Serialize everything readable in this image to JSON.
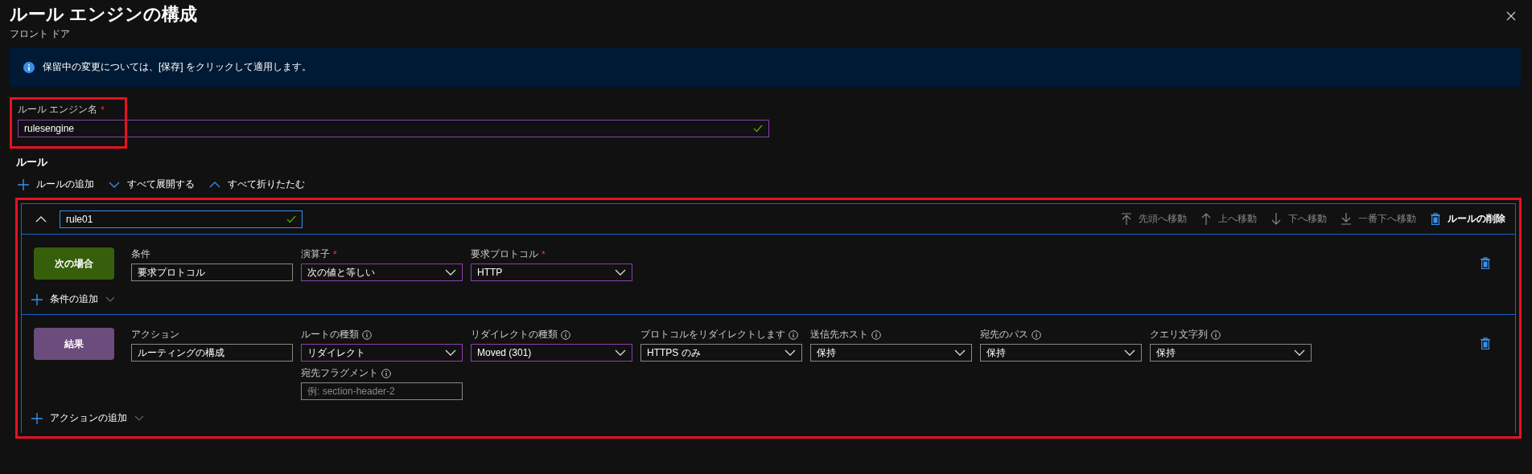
{
  "panel": {
    "title": "ルール エンジンの構成",
    "subtitle": "フロント ドア"
  },
  "banner": {
    "text": "保留中の変更については、[保存] をクリックして適用します。"
  },
  "engine_name": {
    "label": "ルール エンジン名",
    "required_mark": "*",
    "value": "rulesengine",
    "valid": true,
    "highlighted": true
  },
  "rules_section": {
    "heading": "ルール",
    "actions": [
      {
        "kind": "add",
        "label": "ルールの追加"
      },
      {
        "kind": "expand",
        "label": "すべて展開する"
      },
      {
        "kind": "collapse",
        "label": "すべて折りたたむ"
      }
    ]
  },
  "rule": {
    "name": "rule01",
    "valid": true,
    "expanded": true,
    "highlighted": true,
    "commands": [
      {
        "kind": "top",
        "label": "先頭へ移動",
        "disabled": true
      },
      {
        "kind": "up",
        "label": "上へ移動",
        "disabled": true
      },
      {
        "kind": "down",
        "label": "下へ移動",
        "disabled": true
      },
      {
        "kind": "bottom",
        "label": "一番下へ移動",
        "disabled": true
      },
      {
        "kind": "delete",
        "label": "ルールの削除",
        "disabled": false
      }
    ],
    "sections": [
      {
        "kind": "condition",
        "badge": "次の場合",
        "add_label": "条件の追加",
        "columns": [
          {
            "fields": [
              {
                "kind": "text",
                "label": "条件",
                "info": false,
                "accent": false,
                "value": "要求プロトコル"
              }
            ]
          },
          {
            "fields": [
              {
                "kind": "select",
                "label": "演算子",
                "required_mark": "*",
                "info": false,
                "accent": true,
                "value": "次の値と等しい"
              }
            ]
          },
          {
            "fields": [
              {
                "kind": "select",
                "label": "要求プロトコル",
                "required_mark": "*",
                "info": false,
                "accent": true,
                "value": "HTTP"
              }
            ]
          }
        ]
      },
      {
        "kind": "action",
        "badge": "結果",
        "add_label": "アクションの追加",
        "columns": [
          {
            "fields": [
              {
                "kind": "text",
                "label": "アクション",
                "info": false,
                "accent": false,
                "value": "ルーティングの構成"
              }
            ]
          },
          {
            "fields": [
              {
                "kind": "select",
                "label": "ルートの種類",
                "info": true,
                "accent": true,
                "value": "リダイレクト"
              },
              {
                "kind": "text",
                "label": "宛先フラグメント",
                "info": true,
                "accent": false,
                "placeholder": "例: section-header-2"
              }
            ]
          },
          {
            "fields": [
              {
                "kind": "select",
                "label": "リダイレクトの種類",
                "info": true,
                "accent": true,
                "value": "Moved (301)"
              }
            ]
          },
          {
            "fields": [
              {
                "kind": "select",
                "label": "プロトコルをリダイレクトします",
                "info": true,
                "accent": false,
                "value": "HTTPS のみ"
              }
            ]
          },
          {
            "fields": [
              {
                "kind": "select",
                "label": "送信先ホスト",
                "info": true,
                "accent": false,
                "value": "保持"
              }
            ]
          },
          {
            "fields": [
              {
                "kind": "select",
                "label": "宛先のパス",
                "info": true,
                "accent": false,
                "value": "保持"
              }
            ]
          },
          {
            "fields": [
              {
                "kind": "select",
                "label": "クエリ文字列",
                "info": true,
                "accent": false,
                "value": "保持"
              }
            ]
          }
        ]
      }
    ]
  }
}
